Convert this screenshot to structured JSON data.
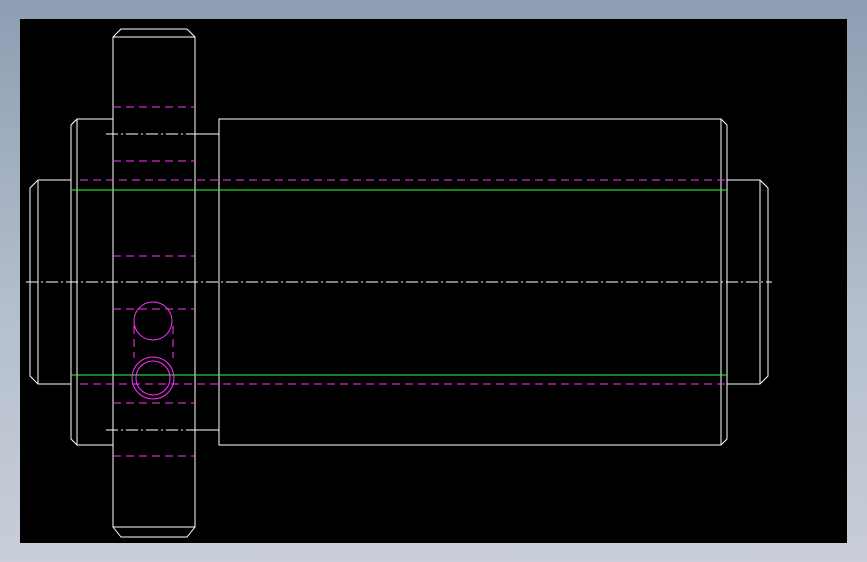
{
  "viewport": {
    "background": "#000000",
    "page_background": "#aeb9c8"
  },
  "colors": {
    "outline": "#ffffff",
    "hidden_line": "#ff33ff",
    "thread_line": "#33ff33",
    "center_line": "#ffffff"
  },
  "drawing": {
    "kind": "CAD orthographic view",
    "parts": [
      "flange-collar",
      "bushing-body",
      "left-stub",
      "right-stub"
    ],
    "features": [
      "center-line",
      "hidden-bore-lines",
      "thread-lines",
      "cross-holes"
    ]
  }
}
